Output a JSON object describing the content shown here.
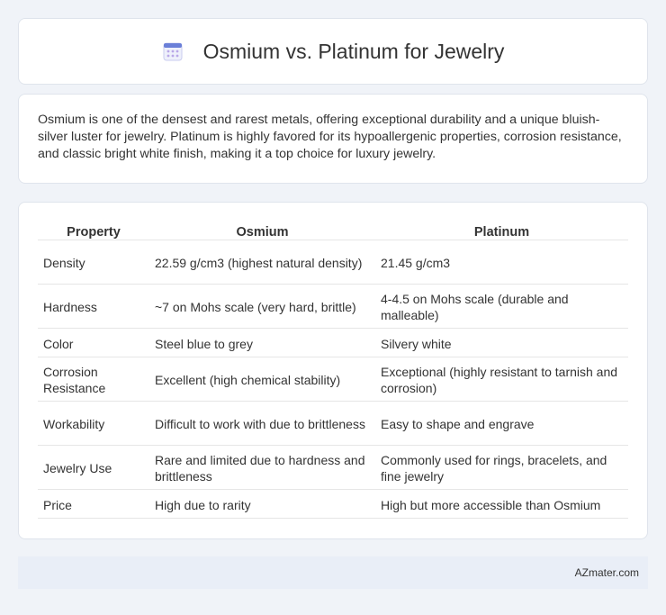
{
  "header": {
    "icon": "calendar-icon",
    "title": "Osmium vs. Platinum for Jewelry"
  },
  "intro": {
    "text": "Osmium is one of the densest and rarest metals, offering exceptional durability and a unique bluish-silver luster for jewelry. Platinum is highly favored for its hypoallergenic properties, corrosion resistance, and classic bright white finish, making it a top choice for luxury jewelry."
  },
  "table": {
    "headers": [
      "Property",
      "Osmium",
      "Platinum"
    ],
    "rows": [
      [
        "Density",
        "22.59 g/cm3 (highest natural density)",
        "21.45 g/cm3"
      ],
      [
        "Hardness",
        "~7 on Mohs scale (very hard, brittle)",
        "4-4.5 on Mohs scale (durable and malleable)"
      ],
      [
        "Color",
        "Steel blue to grey",
        "Silvery white"
      ],
      [
        "Corrosion Resistance",
        "Excellent (high chemical stability)",
        "Exceptional (highly resistant to tarnish and corrosion)"
      ],
      [
        "Workability",
        "Difficult to work with due to brittleness",
        "Easy to shape and engrave"
      ],
      [
        "Jewelry Use",
        "Rare and limited due to hardness and brittleness",
        "Commonly used for rings, bracelets, and fine jewelry"
      ],
      [
        "Price",
        "High due to rarity",
        "High but more accessible than Osmium"
      ]
    ]
  },
  "footer": {
    "brand": "AZmater.com"
  },
  "colors": {
    "background": "#f0f3f8",
    "card": "#ffffff",
    "footer_bg": "#e9eef7",
    "icon_top": "#6a7fd8",
    "icon_dots": "#b9a7e8"
  }
}
